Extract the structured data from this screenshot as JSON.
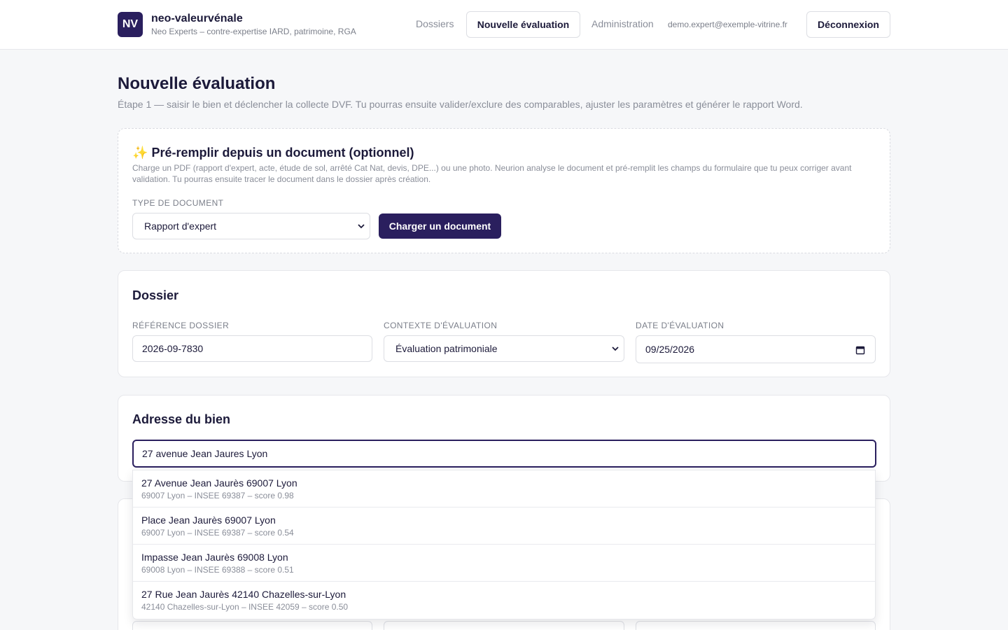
{
  "header": {
    "logo": "NV",
    "app_name": "neo-valeurvénale",
    "app_subtitle": "Neo Experts – contre-expertise IARD, patrimoine, RGA",
    "nav": {
      "dossiers": "Dossiers",
      "nouvelle_evaluation": "Nouvelle évaluation",
      "administration": "Administration"
    },
    "user_email": "demo.expert@exemple-vitrine.fr",
    "logout": "Déconnexion"
  },
  "page": {
    "title": "Nouvelle évaluation",
    "description": "Étape 1 — saisir le bien et déclencher la collecte DVF. Tu pourras ensuite valider/exclure des comparables, ajuster les paramètres et générer le rapport Word."
  },
  "prefill": {
    "emoji": "✨",
    "title": "Pré-remplir depuis un document (optionnel)",
    "description": "Charge un PDF (rapport d'expert, acte, étude de sol, arrêté Cat Nat, devis, DPE...) ou une photo. Neurion analyse le document et pré-remplit les champs du formulaire que tu peux corriger avant validation. Tu pourras ensuite tracer le document dans le dossier après création.",
    "doc_type_label": "TYPE DE DOCUMENT",
    "doc_type_value": "Rapport d'expert",
    "upload_button": "Charger un document"
  },
  "dossier": {
    "title": "Dossier",
    "reference_label": "RÉFÉRENCE DOSSIER",
    "reference_value": "2026-09-7830",
    "context_label": "CONTEXTE D'ÉVALUATION",
    "context_value": "Évaluation patrimoniale",
    "date_label": "DATE D'ÉVALUATION",
    "date_value": "09/25/2026"
  },
  "address": {
    "title": "Adresse du bien",
    "input_value": "27 avenue Jean Jaures Lyon",
    "suggestions": [
      {
        "label": "27 Avenue Jean Jaurès 69007 Lyon",
        "detail": "69007 Lyon – INSEE 69387 – score 0.98"
      },
      {
        "label": "Place Jean Jaurès 69007 Lyon",
        "detail": "69007 Lyon – INSEE 69387 – score 0.54"
      },
      {
        "label": "Impasse Jean Jaurès 69008 Lyon",
        "detail": "69008 Lyon – INSEE 69388 – score 0.51"
      },
      {
        "label": "27 Rue Jean Jaurès 42140 Chazelles-sur-Lyon",
        "detail": "42140 Chazelles-sur-Lyon – INSEE 42059 – score 0.50"
      }
    ]
  },
  "colors": {
    "brand": "#2a1f5e",
    "background": "#f6f7f9",
    "muted_text": "#8a8e99"
  },
  "icons": {
    "select": "chevron-down-icon",
    "date": "calendar-icon"
  }
}
